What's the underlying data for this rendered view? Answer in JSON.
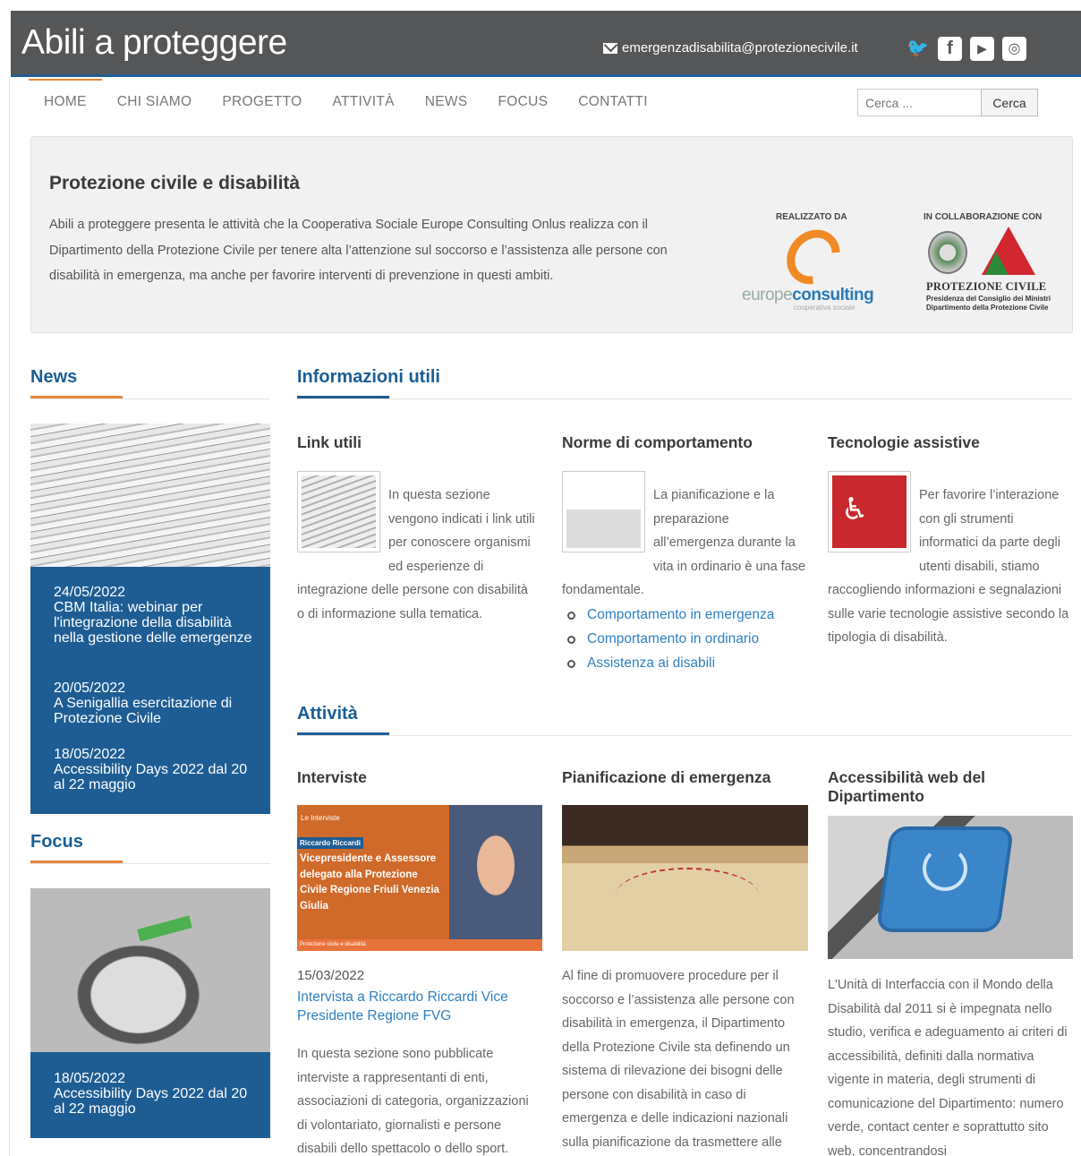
{
  "header": {
    "site_title": "Abili a proteggere",
    "email": "emergenzadisabilita@protezionecivile.it",
    "social_icons": [
      "twitter-icon",
      "facebook-icon",
      "youtube-icon",
      "instagram-icon"
    ]
  },
  "nav": {
    "items": [
      "HOME",
      "CHI SIAMO",
      "PROGETTO",
      "ATTIVITÀ",
      "NEWS",
      "FOCUS",
      "CONTATTI"
    ],
    "active_index": 0
  },
  "search": {
    "placeholder": "Cerca ...",
    "button": "Cerca"
  },
  "hero": {
    "title": "Protezione civile e disabilità",
    "text": "Abili a proteggere presenta le attività che la Cooperativa Sociale Europe Consulting Onlus realizza con il Dipartimento della Protezione Civile per tenere alta l’attenzione sul soccorso e l’assistenza alle persone con disabilità in emergenza, ma anche per favorire interventi di prevenzione in questi ambiti.",
    "realizzato_label": "REALIZZATO DA",
    "europe_prefix": "europe",
    "europe_bold": "consulting",
    "europe_sub": "cooperativa sociale",
    "collab_label": "IN COLLABORAZIONE CON",
    "pc_name": "PROTEZIONE CIVILE",
    "pc_sub1": "Presidenza del Consiglio dei Ministri",
    "pc_sub2": "Dipartimento della Protezione Civile"
  },
  "news": {
    "title": "News",
    "items": [
      {
        "date": "24/05/2022",
        "title": "CBM Italia: webinar per l'integrazione della disabilità nella gestione delle emergenze"
      },
      {
        "date": "20/05/2022",
        "title": "A Senigallia esercitazione di Protezione Civile"
      },
      {
        "date": "18/05/2022",
        "title": "Accessibility Days 2022 dal 20 al 22 maggio"
      }
    ]
  },
  "focus": {
    "title": "Focus",
    "item": {
      "date": "18/05/2022",
      "title": "Accessibility Days 2022 dal 20 al 22 maggio"
    }
  },
  "info": {
    "title": "Informazioni utili",
    "link_utili": {
      "title": "Link utili",
      "text": "In questa sezione vengono indicati i link utili per conoscere organismi ed esperienze di integrazione delle persone con disabilità o di informazione sulla tematica."
    },
    "norme": {
      "title": "Norme di comportamento",
      "text": "La pianificazione e la preparazione all’emergenza durante la vita in ordinario è una fase fondamentale.",
      "links": [
        "Comportamento in emergenza",
        "Comportamento in ordinario",
        "Assistenza ai disabili"
      ]
    },
    "tecnologie": {
      "title": "Tecnologie assistive",
      "text": "Per favorire l’interazione con gli strumenti informatici da parte degli utenti disabili, stiamo raccogliendo informazioni e segnalazioni sulle varie tecnologie assistive secondo la tipologia di disabilità."
    }
  },
  "attivita": {
    "title": "Attività",
    "interviste": {
      "title": "Interviste",
      "image_brand": "Le Interviste",
      "image_tag": "Riccardo Riccardi",
      "image_caption": "Vicepresidente e Assessore delegato alla Protezione Civile Regione Friuli Venezia Giulia",
      "image_footer": "Protezione civile e disabilità",
      "date": "15/03/2022",
      "link": "Intervista a Riccardo Riccardi Vice Presidente Regione FVG",
      "text": "In questa sezione sono pubblicate interviste a rappresentanti di enti, associazioni di categoria, organizzazioni di volontariato, giornalisti e persone disabili dello spettacolo o dello sport."
    },
    "pianificazione": {
      "title": "Pianificazione di emergenza",
      "text": "Al fine di promuovere procedure per il soccorso e l’assistenza alle persone con disabilità in emergenza, il Dipartimento della Protezione Civile sta definendo un sistema di rilevazione dei bisogni delle persone con disabilità in caso di emergenza e delle indicazioni nazionali sulla pianificazione da trasmettere alle"
    },
    "accessibilita": {
      "title": "Accessibilità web del Dipartimento",
      "text": "L'Unità di Interfaccia con il Mondo della Disabilità dal 2011 si è impegnata nello studio, verifica e adeguamento ai criteri di accessibilità, definiti dalla normativa vigente in materia, degli strumenti di comunicazione del Dipartimento: numero verde, contact center e soprattutto sito web, concentrandosi"
    }
  },
  "colors": {
    "primary_blue": "#1e5d93",
    "accent_orange": "#e8883c",
    "header_gray": "#555658",
    "link": "#2f7fc1"
  }
}
